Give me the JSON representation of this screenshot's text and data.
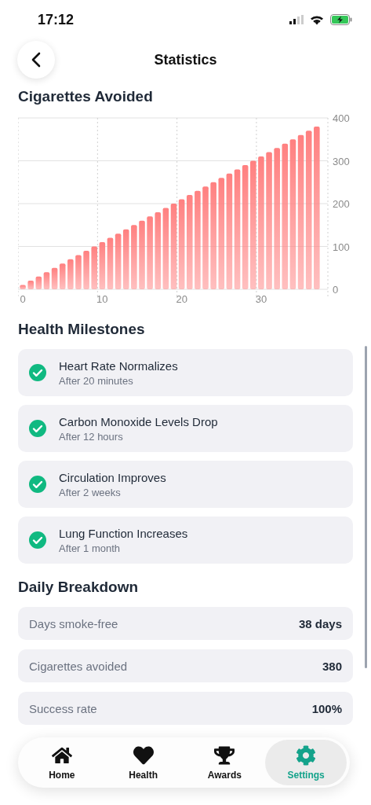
{
  "status_bar": {
    "time": "17:12"
  },
  "header": {
    "title": "Statistics"
  },
  "chart_section": {
    "title": "Cigarettes Avoided",
    "chart_data": {
      "type": "bar",
      "x": [
        0,
        1,
        2,
        3,
        4,
        5,
        6,
        7,
        8,
        9,
        10,
        11,
        12,
        13,
        14,
        15,
        16,
        17,
        18,
        19,
        20,
        21,
        22,
        23,
        24,
        25,
        26,
        27,
        28,
        29,
        30,
        31,
        32,
        33,
        34,
        35,
        36,
        37
      ],
      "series": [
        {
          "color": "#ff8080",
          "values": [
            10,
            20,
            30,
            40,
            50,
            60,
            70,
            80,
            90,
            100,
            110,
            120,
            130,
            140,
            150,
            160,
            170,
            180,
            190,
            200,
            210,
            220,
            230,
            240,
            250,
            260,
            270,
            280,
            290,
            300,
            310,
            320,
            330,
            340,
            350,
            360,
            370,
            380
          ]
        }
      ],
      "xlim": [
        -0.6,
        38.4
      ],
      "grid": true,
      "ylim": [
        0,
        400
      ],
      "xticks": [
        0,
        10,
        20,
        30
      ],
      "yticks": [
        0,
        100,
        200,
        300,
        400
      ]
    }
  },
  "milestones": {
    "title": "Health Milestones",
    "items": [
      {
        "title": "Heart Rate Normalizes",
        "subtitle": "After 20 minutes",
        "achieved": true
      },
      {
        "title": "Carbon Monoxide Levels Drop",
        "subtitle": "After 12 hours",
        "achieved": true
      },
      {
        "title": "Circulation Improves",
        "subtitle": "After 2 weeks",
        "achieved": true
      },
      {
        "title": "Lung Function Increases",
        "subtitle": "After 1 month",
        "achieved": true
      }
    ]
  },
  "breakdown": {
    "title": "Daily Breakdown",
    "rows": [
      {
        "label": "Days smoke-free",
        "value": "38 days"
      },
      {
        "label": "Cigarettes avoided",
        "value": "380"
      },
      {
        "label": "Success rate",
        "value": "100%"
      }
    ]
  },
  "tab_bar": [
    {
      "kind": "home",
      "label": "Home",
      "selected": false
    },
    {
      "kind": "health",
      "label": "Health",
      "selected": false
    },
    {
      "kind": "awards",
      "label": "Awards",
      "selected": false
    },
    {
      "kind": "settings",
      "label": "Settings",
      "selected": true
    }
  ]
}
